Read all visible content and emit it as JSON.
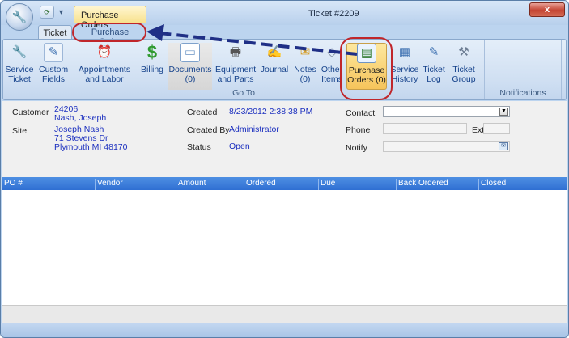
{
  "window": {
    "title": "Ticket #2209",
    "context_tab_title": "Purchase Orders",
    "close_label": "x"
  },
  "tabs": [
    {
      "label": "Ticket"
    },
    {
      "label": "Purchase Order"
    }
  ],
  "ribbon": {
    "buttons": [
      {
        "label": "Service\nTicket",
        "icon": "wrench-icon"
      },
      {
        "label": "Custom\nFields",
        "icon": "form-edit-icon"
      },
      {
        "label": "Appointments\nand Labor",
        "icon": "clock-icon"
      },
      {
        "label": "Billing",
        "icon": "dollar-icon"
      },
      {
        "label": "Documents\n(0)",
        "icon": "document-icon"
      },
      {
        "label": "Equipment\nand Parts",
        "icon": "printer-icon"
      },
      {
        "label": "Journal",
        "icon": "journal-icon"
      },
      {
        "label": "Notes\n(0)",
        "icon": "envelope-icon"
      },
      {
        "label": "Other\nItems",
        "icon": "tag-icon"
      },
      {
        "label": "Purchase\nOrders (0)",
        "icon": "purchase-order-icon"
      },
      {
        "label": "Service\nHistory",
        "icon": "history-icon"
      },
      {
        "label": "Ticket\nLog",
        "icon": "log-icon"
      },
      {
        "label": "Ticket\nGroup",
        "icon": "group-wrench-icon"
      }
    ],
    "group_goto": "Go To",
    "group_notifications": "Notifications"
  },
  "details": {
    "customer_label": "Customer",
    "customer_id": "24206",
    "customer_name": "Nash, Joseph",
    "site_label": "Site",
    "site_name": "Joseph Nash",
    "site_address1": "71  Stevens Dr",
    "site_address2": "Plymouth MI 48170",
    "created_label": "Created",
    "created_value": "8/23/2012 2:38:38 PM",
    "created_by_label": "Created By",
    "created_by_value": "Administrator",
    "status_label": "Status",
    "status_value": "Open",
    "contact_label": "Contact",
    "contact_value": "",
    "phone_label": "Phone",
    "phone_value": "",
    "ext_label": "Ext",
    "ext_value": "",
    "notify_label": "Notify",
    "notify_value": ""
  },
  "grid": {
    "columns": [
      "PO #",
      "Vendor",
      "Amount",
      "Ordered",
      "Due",
      "Back Ordered",
      "Closed"
    ],
    "header_color": "#3f7fdc"
  },
  "colors": {
    "annotation": "#c0262b",
    "arrow": "#1f2f86",
    "highlight": "#f6c45b",
    "link_text": "#1b2fbf"
  }
}
